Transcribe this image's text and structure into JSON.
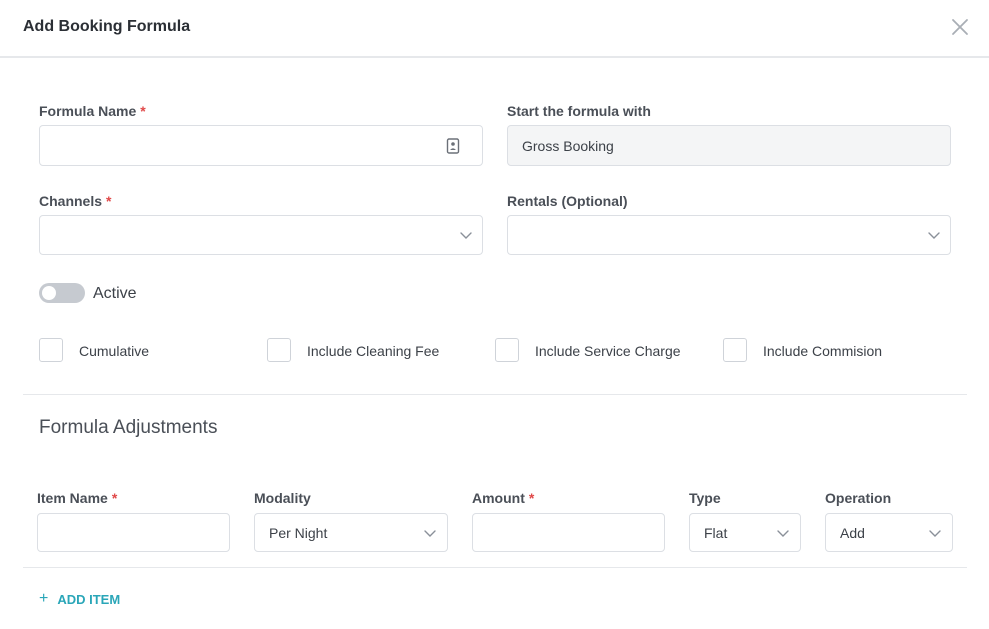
{
  "modal": {
    "title": "Add Booking Formula",
    "close_icon": "close-icon"
  },
  "form": {
    "formula_name": {
      "label": "Formula Name",
      "required": "*",
      "value": ""
    },
    "start_with": {
      "label": "Start the formula with",
      "value": "Gross Booking"
    },
    "channels": {
      "label": "Channels",
      "required": "*",
      "value": ""
    },
    "rentals": {
      "label": "Rentals (Optional)",
      "value": ""
    },
    "active_toggle": {
      "label": "Active",
      "on": false
    },
    "checkboxes": [
      {
        "label": "Cumulative",
        "checked": false
      },
      {
        "label": "Include Cleaning Fee",
        "checked": false
      },
      {
        "label": "Include Service Charge",
        "checked": false
      },
      {
        "label": "Include Commision",
        "checked": false
      }
    ]
  },
  "adjustments": {
    "title": "Formula Adjustments",
    "columns": {
      "item_name": {
        "label": "Item Name",
        "required": "*"
      },
      "modality": {
        "label": "Modality"
      },
      "amount": {
        "label": "Amount",
        "required": "*"
      },
      "type": {
        "label": "Type"
      },
      "operation": {
        "label": "Operation"
      }
    },
    "row": {
      "item_name": "",
      "modality": "Per Night",
      "amount": "",
      "type": "Flat",
      "operation": "Add"
    },
    "add_item": {
      "plus": "+",
      "label": "ADD ITEM"
    }
  },
  "colors": {
    "accent": "#2aa6b8",
    "required": "#e04848",
    "toggle_off": "#c6cad0"
  }
}
